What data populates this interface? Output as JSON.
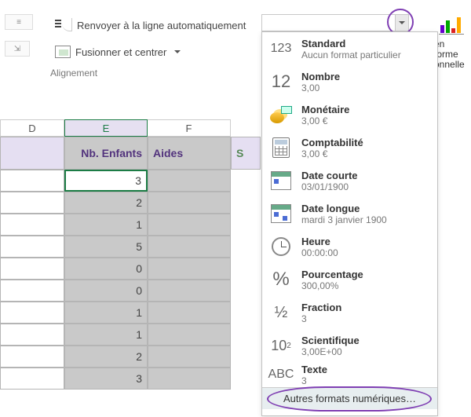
{
  "ribbon": {
    "wrap_text_label": "Renvoyer à la ligne automatiquement",
    "merge_label": "Fusionner et centrer",
    "group_label": "Alignement",
    "formula_value": "",
    "conditional_btn_line1": "en forme",
    "conditional_btn_line2": "onnelle"
  },
  "number_format": {
    "items": [
      {
        "title": "Standard",
        "sub": "Aucun format particulier",
        "icon": "123"
      },
      {
        "title": "Nombre",
        "sub": "3,00",
        "icon": "12"
      },
      {
        "title": "Monétaire",
        "sub": "3,00 €",
        "icon": "coins"
      },
      {
        "title": "Comptabilité",
        "sub": " 3,00 €",
        "icon": "calc"
      },
      {
        "title": "Date courte",
        "sub": "03/01/1900",
        "icon": "date-short"
      },
      {
        "title": "Date longue",
        "sub": "mardi 3 janvier 1900",
        "icon": "date-long"
      },
      {
        "title": "Heure",
        "sub": "00:00:00",
        "icon": "clock"
      },
      {
        "title": "Pourcentage",
        "sub": "300,00%",
        "icon": "%"
      },
      {
        "title": "Fraction",
        "sub": "3",
        "icon": "1/2"
      },
      {
        "title": "Scientifique",
        "sub": "3,00E+00",
        "icon": "10^2"
      },
      {
        "title": "Texte",
        "sub": "3",
        "icon": "ABC"
      }
    ],
    "more_label": "Autres formats numériques…"
  },
  "sheet": {
    "columns": {
      "d": "D",
      "e": "E",
      "f": "F"
    },
    "headers": {
      "d": "",
      "e": "Nb. Enfants",
      "f": "Aides",
      "s": "S"
    },
    "cells_e": [
      "3",
      "2",
      "1",
      "5",
      "0",
      "0",
      "1",
      "1",
      "2",
      "3"
    ]
  }
}
